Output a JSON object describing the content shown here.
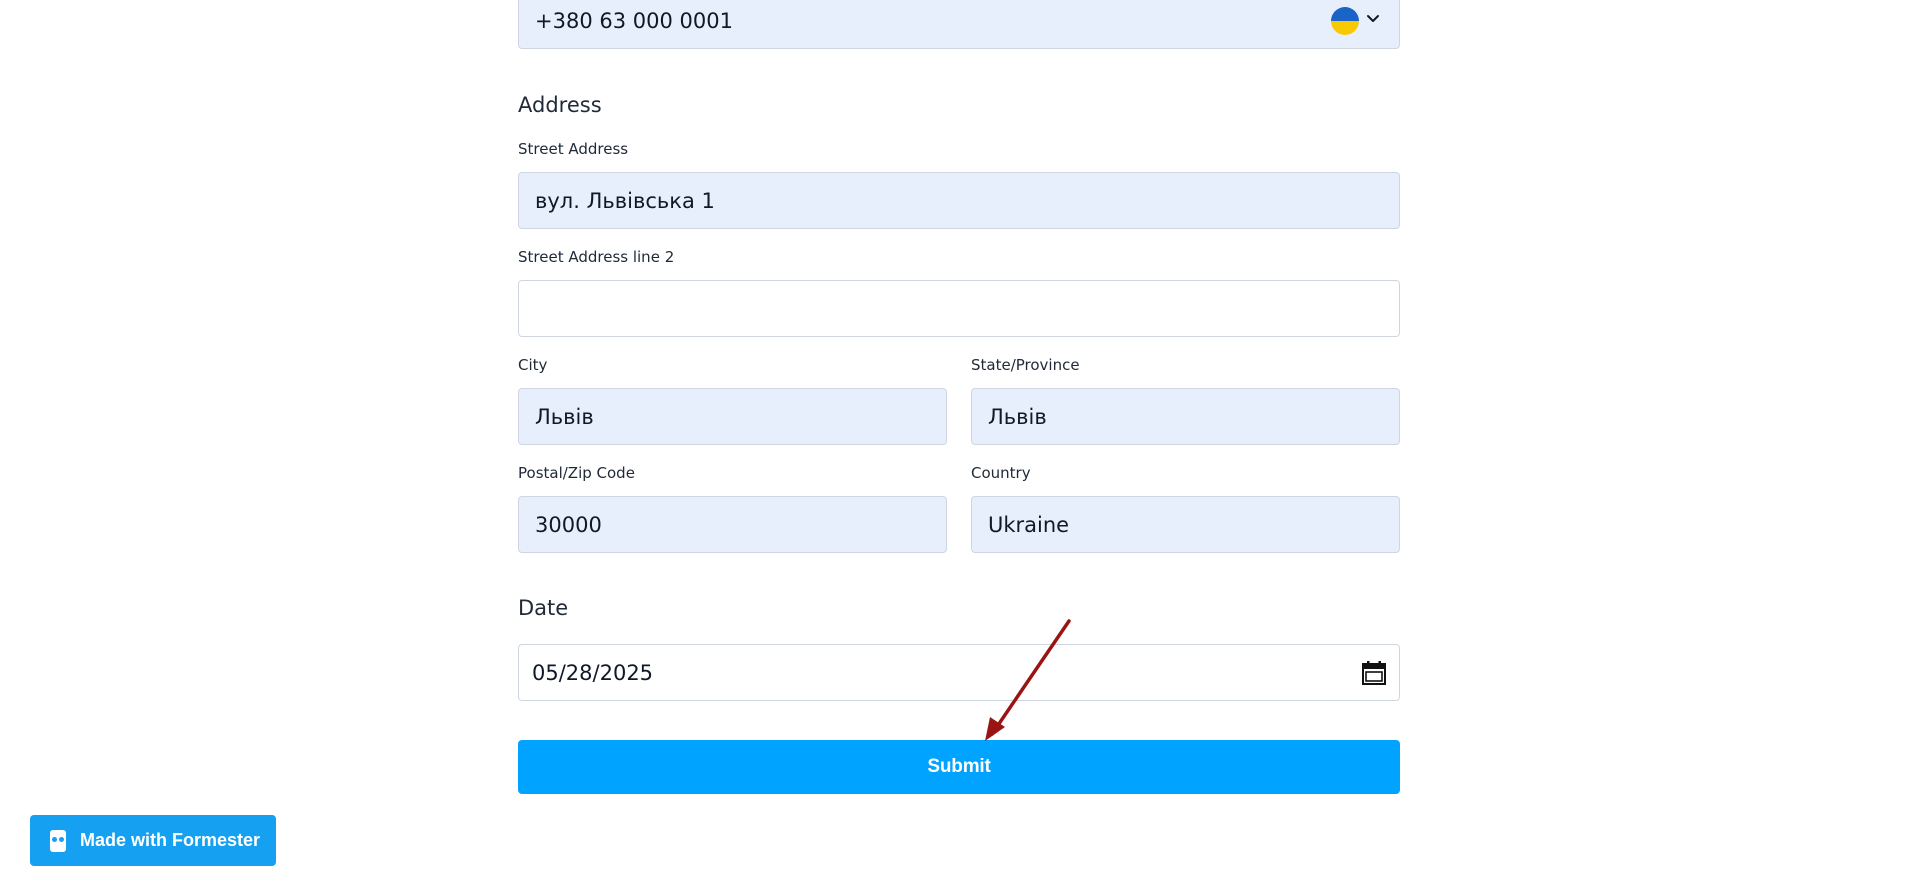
{
  "phone": {
    "value": "+380 63 000 0001",
    "flag_icon": "ukraine-flag-icon",
    "dropdown_icon": "chevron-down-icon"
  },
  "address": {
    "title": "Address",
    "street_label": "Street Address",
    "street_value": "вул. Львівська 1",
    "street2_label": "Street Address line 2",
    "street2_value": "",
    "city_label": "City",
    "city_value": "Львів",
    "state_label": "State/Province",
    "state_value": "Львів",
    "zip_label": "Postal/Zip Code",
    "zip_value": "30000",
    "country_label": "Country",
    "country_value": "Ukraine"
  },
  "date": {
    "title": "Date",
    "value": "05/28/2025",
    "icon": "calendar-icon"
  },
  "submit_label": "Submit",
  "badge_label": "Made with Formester",
  "colors": {
    "accent": "#00a3ff",
    "badge": "#15a0f2",
    "filled_bg": "#e8effc",
    "annotation_arrow": "#9b1414"
  }
}
